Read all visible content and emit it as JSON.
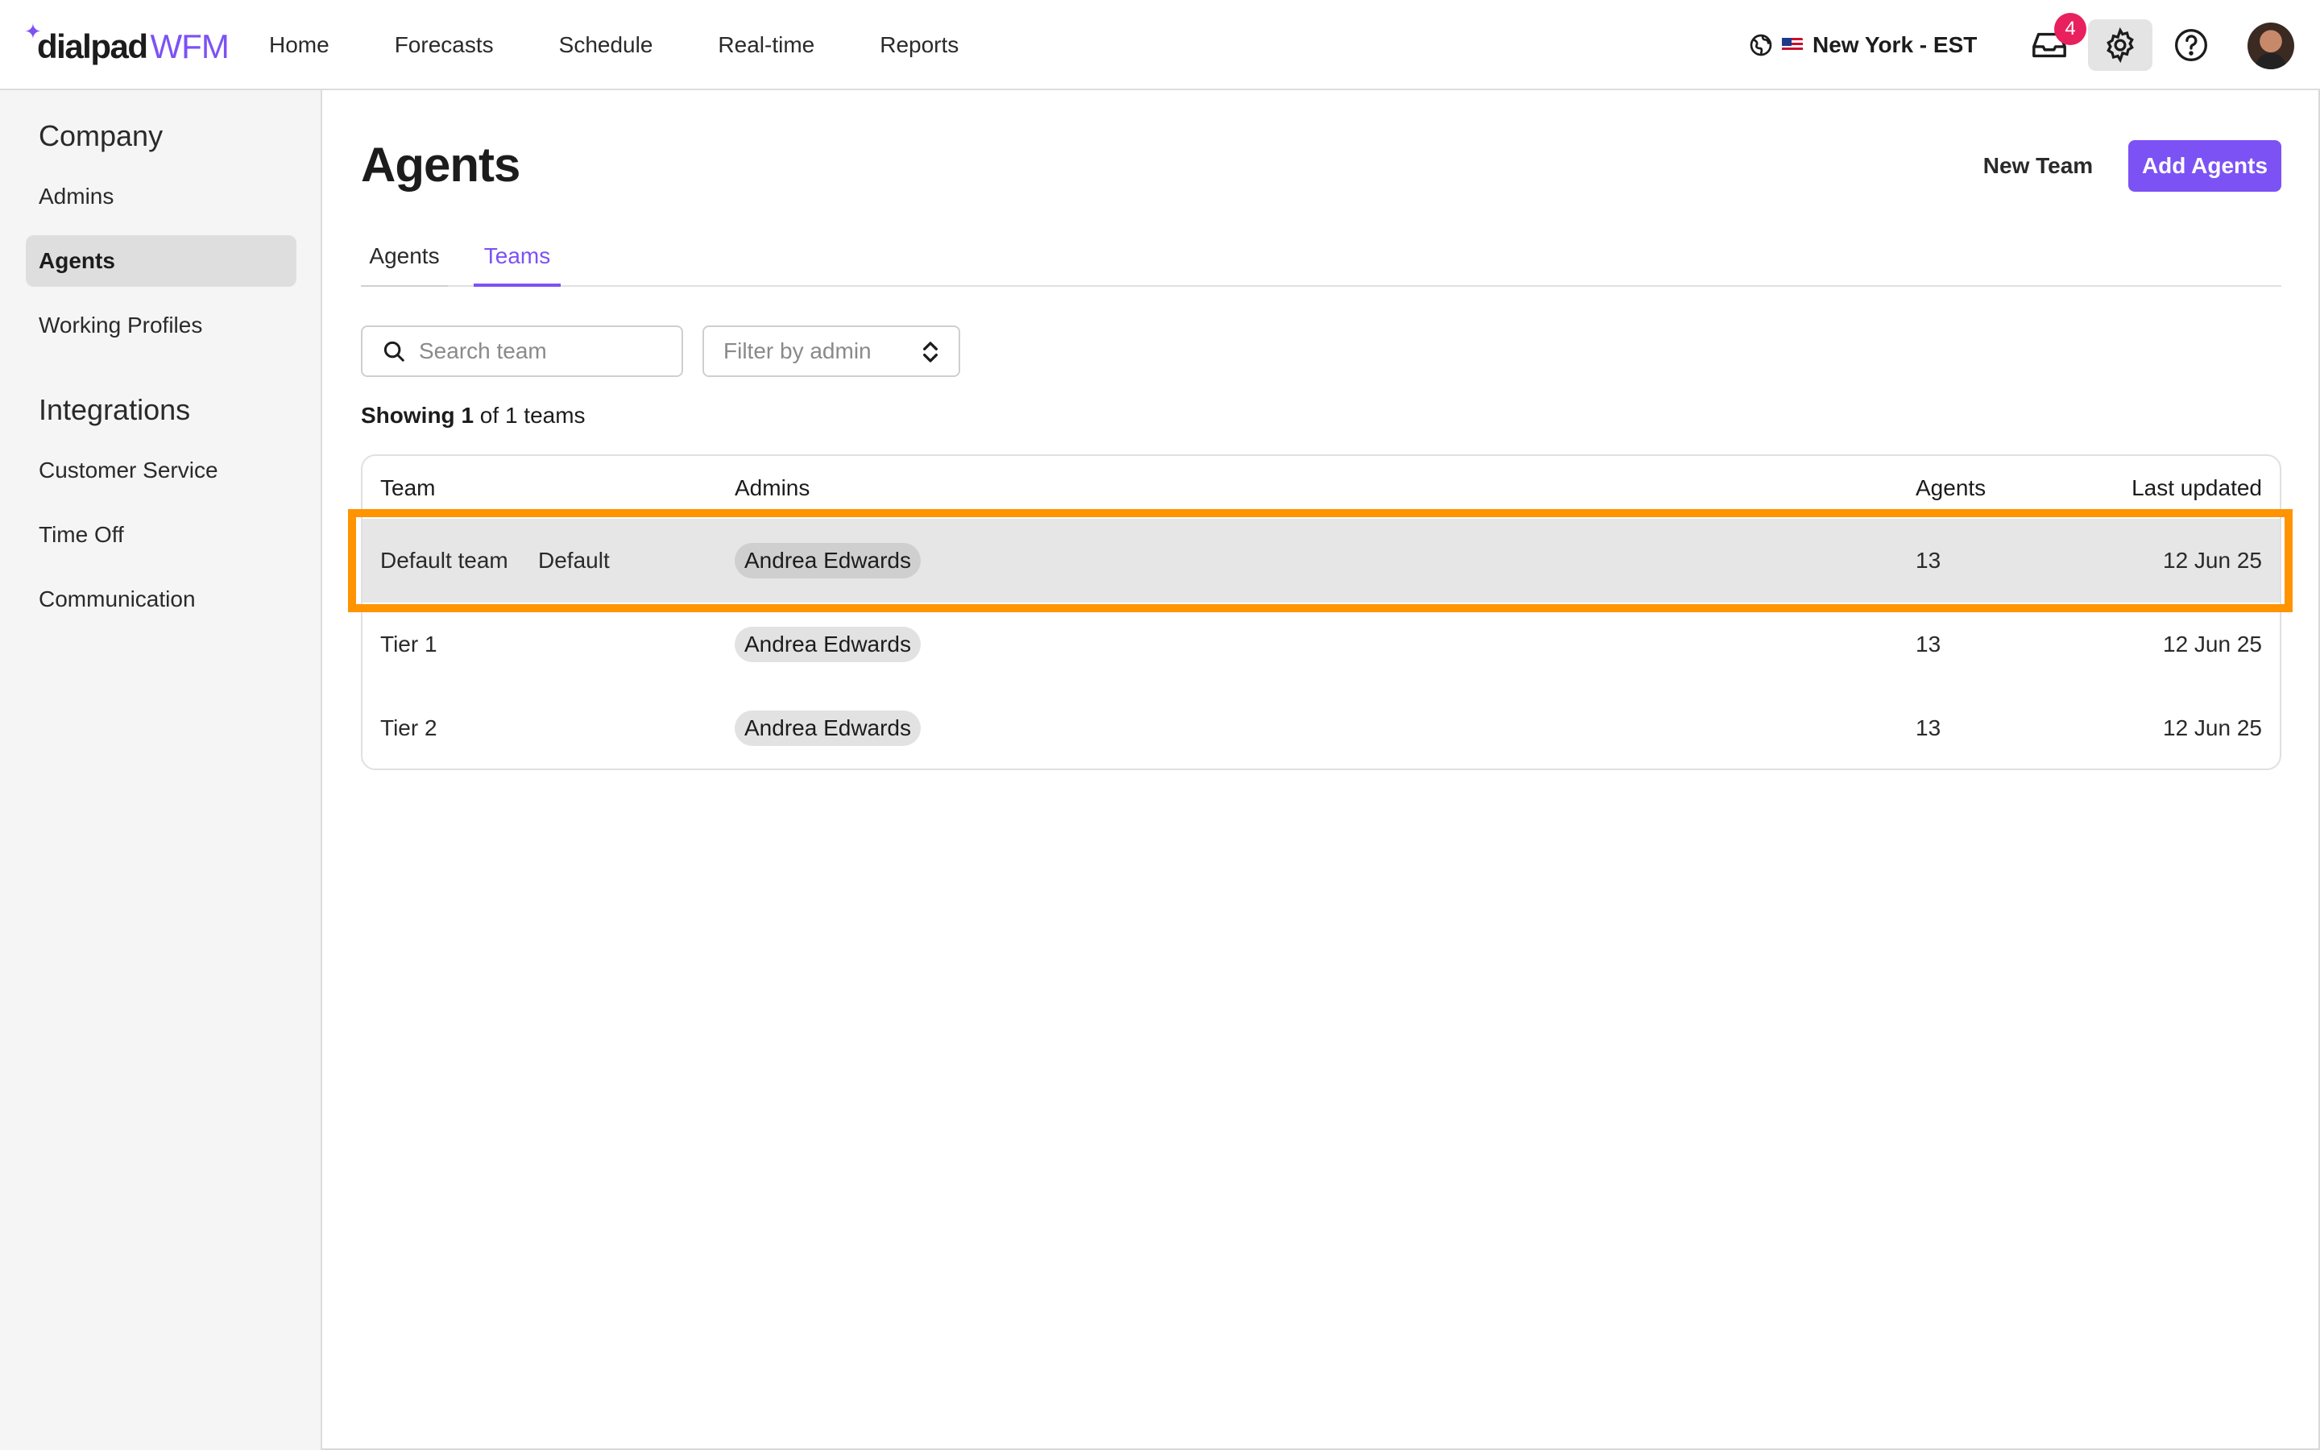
{
  "brand": {
    "name": "dialpad",
    "product": "WFM"
  },
  "nav": [
    "Home",
    "Forecasts",
    "Schedule",
    "Real-time",
    "Reports"
  ],
  "timezone": "New York - EST",
  "notifications": {
    "count": "4"
  },
  "sidebar": {
    "sections": [
      {
        "title": "Company",
        "items": [
          "Admins",
          "Agents",
          "Working Profiles"
        ]
      },
      {
        "title": "Integrations",
        "items": [
          "Customer Service",
          "Time Off",
          "Communication"
        ]
      }
    ],
    "active_item": "Agents"
  },
  "page": {
    "title": "Agents",
    "new_team_label": "New Team",
    "add_agents_label": "Add Agents",
    "tabs": [
      "Agents",
      "Teams"
    ],
    "active_tab": "Teams"
  },
  "search": {
    "placeholder": "Search team"
  },
  "filter": {
    "placeholder": "Filter by admin"
  },
  "showing": {
    "prefix": "Showing",
    "count": "1",
    "middle": "of",
    "total": "1",
    "suffix": "teams"
  },
  "table": {
    "headers": [
      "Team",
      "Admins",
      "Agents",
      "Last updated"
    ],
    "rows": [
      {
        "team": "Default team",
        "tag": "Default",
        "admin": "Andrea Edwards",
        "agents": "13",
        "updated": "12 Jun 25",
        "selected": true
      },
      {
        "team": "Tier 1",
        "tag": "",
        "admin": "Andrea Edwards",
        "agents": "13",
        "updated": "12 Jun 25",
        "selected": false
      },
      {
        "team": "Tier 2",
        "tag": "",
        "admin": "Andrea Edwards",
        "agents": "13",
        "updated": "12 Jun 25",
        "selected": false
      }
    ]
  },
  "colors": {
    "accent": "#7c52f4",
    "highlight": "#ff9300",
    "badge": "#e8205e"
  }
}
